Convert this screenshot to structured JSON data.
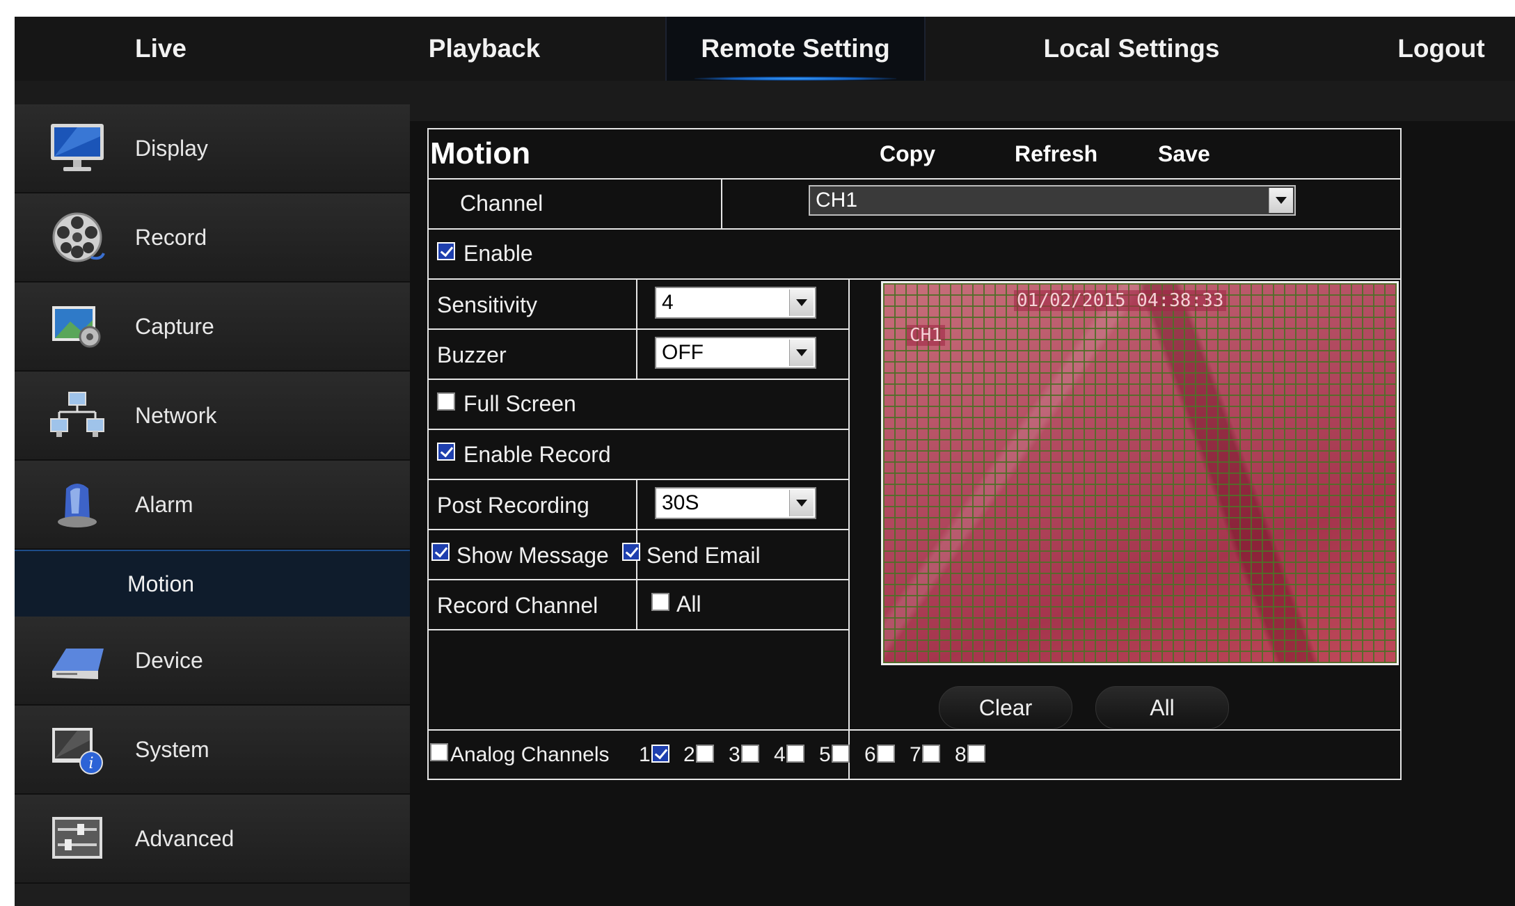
{
  "nav": {
    "items": [
      "Live",
      "Playback",
      "Remote Setting",
      "Local Settings",
      "Logout"
    ],
    "active": "Remote Setting"
  },
  "sidebar": {
    "items": [
      {
        "label": "Display",
        "icon": "monitor-icon"
      },
      {
        "label": "Record",
        "icon": "film-reel-icon"
      },
      {
        "label": "Capture",
        "icon": "capture-gear-icon"
      },
      {
        "label": "Network",
        "icon": "network-icon"
      },
      {
        "label": "Alarm",
        "icon": "alarm-siren-icon"
      },
      {
        "label": "Device",
        "icon": "hard-drive-icon"
      },
      {
        "label": "System",
        "icon": "system-info-icon"
      },
      {
        "label": "Advanced",
        "icon": "sliders-icon"
      }
    ],
    "active_sub": "Motion"
  },
  "panel": {
    "title": "Motion",
    "toolbar": {
      "copy": "Copy",
      "refresh": "Refresh",
      "save": "Save"
    },
    "channel": {
      "label": "Channel",
      "value": "CH1"
    },
    "enable": {
      "label": "Enable",
      "checked": true
    },
    "sensitivity": {
      "label": "Sensitivity",
      "value": "4"
    },
    "buzzer": {
      "label": "Buzzer",
      "value": "OFF"
    },
    "full_screen": {
      "label": "Full Screen",
      "checked": false
    },
    "enable_record": {
      "label": "Enable Record",
      "checked": true
    },
    "post_recording": {
      "label": "Post Recording",
      "value": "30S"
    },
    "show_message": {
      "label": "Show Message",
      "checked": true
    },
    "send_email": {
      "label": "Send Email",
      "checked": true
    },
    "record_channel": {
      "label": "Record Channel",
      "all_label": "All",
      "all_checked": false
    },
    "preview": {
      "timestamp": "01/02/2015 04:38:33",
      "channel_osd": "CH1",
      "clear_label": "Clear",
      "all_label": "All"
    },
    "analog": {
      "label": "Analog Channels",
      "checked": false,
      "channels": [
        {
          "num": "1",
          "checked": true
        },
        {
          "num": "2",
          "checked": false
        },
        {
          "num": "3",
          "checked": false
        },
        {
          "num": "4",
          "checked": false
        },
        {
          "num": "5",
          "checked": false
        },
        {
          "num": "6",
          "checked": false
        },
        {
          "num": "7",
          "checked": false
        },
        {
          "num": "8",
          "checked": false
        }
      ]
    }
  },
  "colors": {
    "background": "#111111",
    "active_sub_bg": "#0f1c2c",
    "accent_blue": "#3aa0ff",
    "motion_overlay": "#b24a60",
    "grid": "#506e28"
  }
}
